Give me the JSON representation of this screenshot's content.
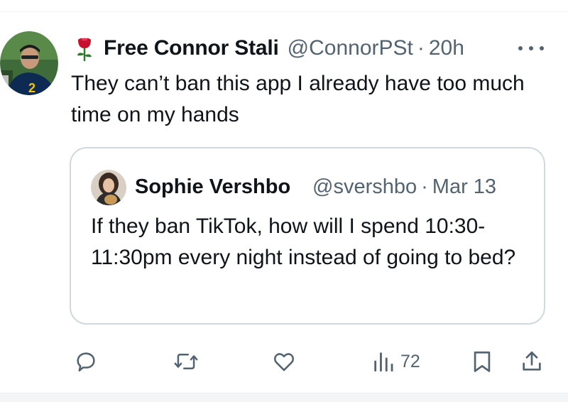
{
  "tweet": {
    "display_name": "Free Connor Stali",
    "handle": "@ConnorPSt",
    "separator": "·",
    "time": "20h",
    "text": "They can’t ban this app I already have too much time on my hands"
  },
  "quoted_tweet": {
    "display_name": "Sophie Vershbo",
    "handle": "@svershbo",
    "separator": "·",
    "time": "Mar 13",
    "text": "If they ban TikTok, how will I spend 10:30-11:30pm every night instead of going to bed?"
  },
  "actions": {
    "views_count": "72"
  },
  "icons": [
    "rose-icon",
    "more-icon",
    "reply-icon",
    "retweet-icon",
    "like-icon",
    "views-icon",
    "bookmark-icon",
    "share-icon"
  ],
  "colors": {
    "text": "#0f1419",
    "secondary": "#536471",
    "border": "#cfd9de",
    "rose": "#c8102e"
  }
}
